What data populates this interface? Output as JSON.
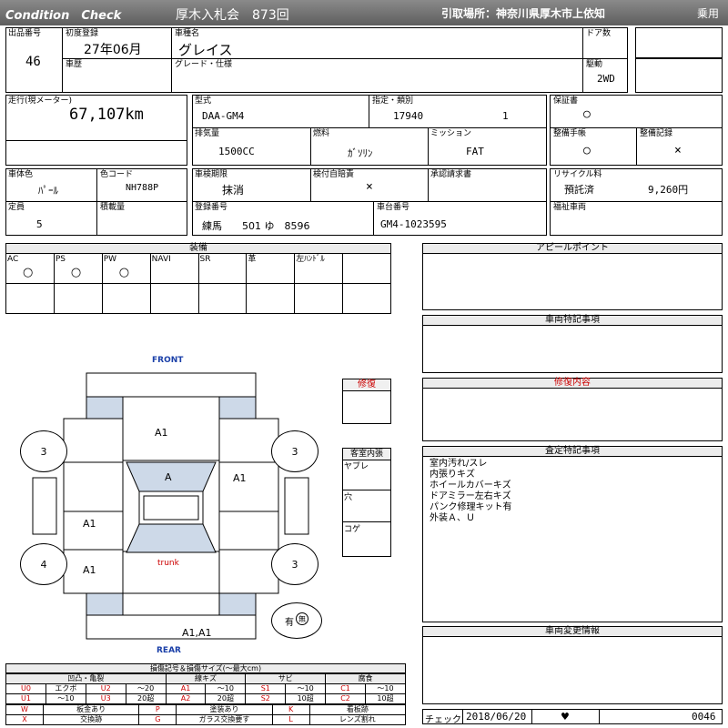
{
  "header": {
    "title": "Condition　Check",
    "auction": "厚木入札会　873回",
    "pickup": "引取場所：神奈川県厚木市上依知",
    "category": "乗用"
  },
  "vehicle": {
    "lot_label": "出品番号",
    "lot": "46",
    "first_reg_label": "初度登録",
    "first_reg": "27年06月",
    "name_label": "車種名",
    "name": "グレイス",
    "door_label": "ドア数",
    "door": "",
    "history_label": "車歴",
    "history": "",
    "grade_label": "グレード・仕様",
    "grade": "",
    "drive_label": "駆動",
    "drive": "2WD",
    "mileage_label": "走行(現メーター)",
    "mileage": "67,107km",
    "model_label": "型式",
    "model": "DAA-GM4",
    "spec_label": "指定・類別",
    "spec_a": "17940",
    "spec_b": "1",
    "warranty_label": "保証書",
    "warranty": "○",
    "disp_label": "排気量",
    "disp": "1500CC",
    "fuel_label": "燃料",
    "fuel": "ｶﾞｿﾘﾝ",
    "mission_label": "ミッション",
    "mission": "FAT",
    "manual_label": "整備手帳",
    "manual": "○",
    "maint_label": "整備記録",
    "maint": "×",
    "color_label": "車体色",
    "color": "ﾊﾟｰﾙ",
    "color_code_label": "色コード",
    "color_code": "NH788P",
    "inspection_label": "車検期限",
    "inspection": "抹消",
    "insurance_label": "検付自賠責",
    "insurance": "×",
    "approval_label": "承認請求書",
    "approval": "",
    "recycle_label": "リサイクル料",
    "recycle_status": "預託済",
    "recycle_fee": "9,260円",
    "capacity_label": "定員",
    "capacity": "5",
    "load_label": "積載量",
    "load": "",
    "plate_label": "登録番号",
    "plate": "練馬　　501 ゆ　8596",
    "chassis_label": "車台番号",
    "chassis": "GM4-1023595",
    "welfare_label": "福祉車両",
    "welfare": ""
  },
  "equipment": {
    "title": "装備",
    "items": [
      {
        "label": "AC",
        "value": "○"
      },
      {
        "label": "PS",
        "value": "○"
      },
      {
        "label": "PW",
        "value": "○"
      },
      {
        "label": "NAVI",
        "value": ""
      },
      {
        "label": "SR",
        "value": ""
      },
      {
        "label": "革",
        "value": ""
      },
      {
        "label": "左ﾊﾝﾄﾞﾙ",
        "value": ""
      },
      {
        "label": "",
        "value": ""
      }
    ]
  },
  "diagram": {
    "front": "FRONT",
    "rear": "REAR",
    "trunk": "trunk",
    "marks": {
      "hood": "A1",
      "windshield": "A",
      "right_front": "A1",
      "left_rear_door": "A1",
      "left_rear_quarter": "A1",
      "rear_bumper": "A1,A1"
    },
    "tires": {
      "fl": "3",
      "fr": "3",
      "rl": "4",
      "rr": "3"
    },
    "with_label": "有",
    "without_label": "無"
  },
  "repair": {
    "title": "修復"
  },
  "interior": {
    "title": "客室内張",
    "items": [
      "ヤブレ",
      "穴",
      "コゲ"
    ]
  },
  "right_panels": {
    "appeal": "アピールポイント",
    "special": "車両特記事項",
    "repair_content": "修復内容",
    "assessment": "査定特記事項",
    "assessment_lines": [
      "室内汚れ/スレ",
      "内張りキズ",
      "ホイールカバーキズ",
      "ドアミラー左右キズ",
      "パンク修理キット有",
      "外装Ａ、Ｕ"
    ],
    "changes": "車両変更情報"
  },
  "legend": {
    "title": "損傷記号＆損傷サイズ(〜最大cm)",
    "groups": [
      "凹凸・亀裂",
      "線キズ",
      "サビ",
      "腐食"
    ],
    "row1": [
      "U0",
      "エクボ",
      "U2",
      "〜20",
      "A1",
      "〜10",
      "S1",
      "〜10",
      "C1",
      "〜10"
    ],
    "row2": [
      "U1",
      "〜10",
      "U3",
      "20超",
      "A2",
      "20超",
      "S2",
      "10超",
      "C2",
      "10超"
    ],
    "row3": [
      "W",
      "板金あり",
      "P",
      "塗装あり",
      "K",
      "看板跡"
    ],
    "row4": [
      "X",
      "交換跡",
      "G",
      "ガラス交換要す",
      "L",
      "レンズ割れ"
    ]
  },
  "check": {
    "label": "チェック",
    "date": "2018/06/20",
    "mark": "♥",
    "number": "0046"
  },
  "colors": {
    "accent_red": "#cc0000",
    "front_blue": "#1a3fa8",
    "glass": "#cdd9e8"
  }
}
